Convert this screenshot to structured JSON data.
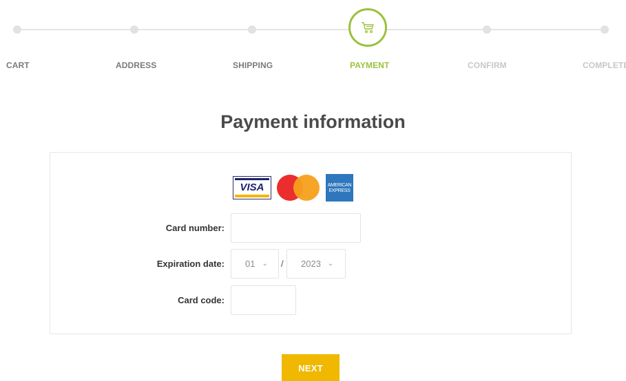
{
  "steps": [
    {
      "label": "CART",
      "state": "done"
    },
    {
      "label": "ADDRESS",
      "state": "done"
    },
    {
      "label": "SHIPPING",
      "state": "done"
    },
    {
      "label": "PAYMENT",
      "state": "active"
    },
    {
      "label": "CONFIRM",
      "state": "todo"
    },
    {
      "label": "COMPLETE",
      "state": "todo"
    }
  ],
  "active_step_icon": "cart-icon",
  "page_title": "Payment information",
  "card_logos": {
    "visa": "VISA",
    "mastercard": "mastercard-logo",
    "amex_line1": "AMERICAN",
    "amex_line2": "EXPRESS"
  },
  "form": {
    "card_number_label": "Card number:",
    "card_number_value": "",
    "expiration_label": "Expiration date:",
    "exp_month": "01",
    "exp_separator": "/",
    "exp_year": "2023",
    "card_code_label": "Card code:",
    "card_code_value": ""
  },
  "next_label": "NEXT",
  "colors": {
    "accent_green": "#9ac13a",
    "button_yellow": "#f0b800"
  }
}
